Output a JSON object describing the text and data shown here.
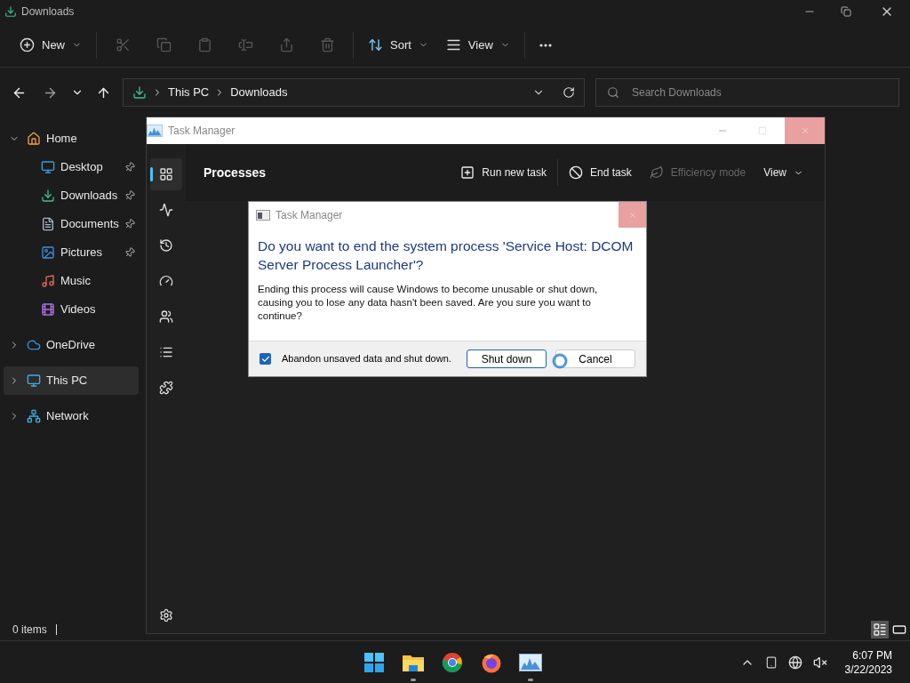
{
  "explorer": {
    "title": "Downloads",
    "toolbar": [
      {
        "kind": "new",
        "label": "New",
        "disabled": false
      },
      {
        "kind": "cut",
        "disabled": true
      },
      {
        "kind": "copy",
        "disabled": true
      },
      {
        "kind": "paste",
        "disabled": true
      },
      {
        "kind": "rename",
        "disabled": true
      },
      {
        "kind": "share",
        "disabled": true
      },
      {
        "kind": "delete",
        "disabled": true
      },
      {
        "kind": "sort",
        "label": "Sort",
        "disabled": false
      },
      {
        "kind": "view",
        "label": "View",
        "disabled": false
      },
      {
        "kind": "more",
        "disabled": false
      }
    ],
    "breadcrumb": [
      "This PC",
      "Downloads"
    ],
    "search": {
      "placeholder": "Search Downloads"
    },
    "sidebar": [
      {
        "kind": "home",
        "label": "Home",
        "expanded": true,
        "selected": false,
        "children": [
          {
            "kind": "desktop",
            "label": "Desktop",
            "pinned": true
          },
          {
            "kind": "downloads",
            "label": "Downloads",
            "pinned": true
          },
          {
            "kind": "documents",
            "label": "Documents",
            "pinned": true
          },
          {
            "kind": "pictures",
            "label": "Pictures",
            "pinned": true
          },
          {
            "kind": "music",
            "label": "Music",
            "pinned": false
          },
          {
            "kind": "videos",
            "label": "Videos",
            "pinned": false
          }
        ]
      },
      {
        "kind": "cloud",
        "label": "OneDrive",
        "expanded": false,
        "selected": false
      },
      {
        "kind": "pc",
        "label": "This PC",
        "expanded": false,
        "selected": true
      },
      {
        "kind": "network",
        "label": "Network",
        "expanded": false,
        "selected": false
      }
    ],
    "status": "0 items",
    "layouts": [
      {
        "kind": "details",
        "selected": true
      },
      {
        "kind": "tiles",
        "selected": false
      }
    ]
  },
  "task_manager": {
    "title": "Task Manager",
    "nav": [
      {
        "kind": "processes",
        "selected": true
      },
      {
        "kind": "performance",
        "selected": false
      },
      {
        "kind": "history",
        "selected": false
      },
      {
        "kind": "startup",
        "selected": false
      },
      {
        "kind": "users",
        "selected": false
      },
      {
        "kind": "details",
        "selected": false
      },
      {
        "kind": "services",
        "selected": false
      }
    ],
    "page_title": "Processes",
    "actions": [
      {
        "kind": "run",
        "label": "Run new task",
        "disabled": false
      },
      {
        "kind": "end",
        "label": "End task",
        "disabled": false
      },
      {
        "kind": "efficiency",
        "label": "Efficiency mode",
        "disabled": true
      },
      {
        "kind": "view",
        "label": "View",
        "disabled": false
      }
    ]
  },
  "dialog": {
    "title": "Task Manager",
    "heading": "Do you want to end the system process 'Service Host: DCOM Server Process Launcher'?",
    "message": "Ending this process will cause Windows to become unusable or shut down, causing you to lose any data hasn't been saved. Are you sure you want to continue?",
    "checkbox": {
      "label": "Abandon unsaved data and shut down.",
      "checked": true
    },
    "buttons": [
      {
        "label": "Shut down",
        "default": true
      },
      {
        "label": "Cancel",
        "default": false
      }
    ]
  },
  "taskbar": {
    "apps": [
      {
        "kind": "start",
        "running": false
      },
      {
        "kind": "files",
        "running": true
      },
      {
        "kind": "chrome",
        "running": false
      },
      {
        "kind": "firefox",
        "running": false
      },
      {
        "kind": "taskmgr",
        "running": true
      }
    ],
    "time": "6:07 PM",
    "date": "3/22/2023"
  }
}
